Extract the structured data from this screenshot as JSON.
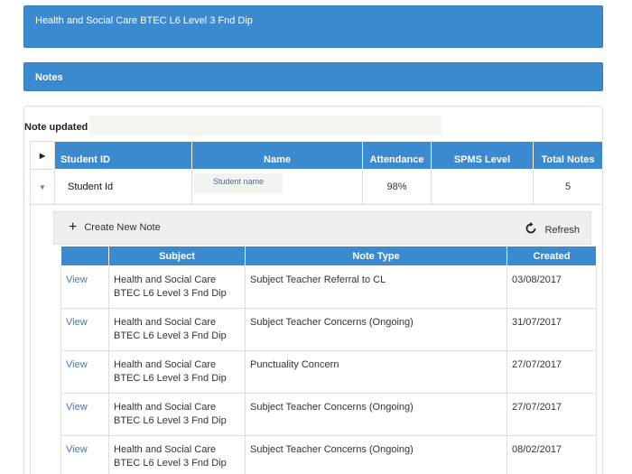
{
  "course_banner": {
    "title": "Health and Social Care BTEC L6 Level 3 Fnd Dip"
  },
  "notes_banner": {
    "title": "Notes"
  },
  "note_updated": {
    "label": "Note updated"
  },
  "student_table": {
    "headers": {
      "student_id": "Student ID",
      "name": "Name",
      "attendance": "Attendance",
      "spms_level": "SPMS Level",
      "total_notes": "Total Notes"
    },
    "row": {
      "student_id": "Student Id",
      "name": "Student name",
      "attendance": "98%",
      "spms_level": "",
      "total_notes": "5"
    }
  },
  "toolbar": {
    "create_label": "Create New Note",
    "refresh_label": "Refresh"
  },
  "notes_table": {
    "headers": {
      "view": "",
      "subject": "Subject",
      "note_type": "Note Type",
      "created": "Created"
    },
    "rows": [
      {
        "view": "View",
        "subject": "Health and Social Care BTEC L6 Level 3 Fnd Dip",
        "note_type": "Subject Teacher Referral to CL",
        "created": "03/08/2017"
      },
      {
        "view": "View",
        "subject": "Health and Social Care BTEC L6 Level 3 Fnd Dip",
        "note_type": "Subject Teacher Concerns (Ongoing)",
        "created": "31/07/2017"
      },
      {
        "view": "View",
        "subject": "Health and Social Care BTEC L6 Level 3 Fnd Dip",
        "note_type": "Punctuality Concern",
        "created": "27/07/2017"
      },
      {
        "view": "View",
        "subject": "Health and Social Care BTEC L6 Level 3 Fnd Dip",
        "note_type": "Subject Teacher Concerns (Ongoing)",
        "created": "27/07/2017"
      },
      {
        "view": "View",
        "subject": "Health and Social Care BTEC L6 Level 3 Fnd Dip",
        "note_type": "Subject Teacher Concerns (Ongoing)",
        "created": "08/02/2017"
      }
    ]
  },
  "icons": {
    "expand": "triangle-right-icon",
    "collapse": "triangle-down-icon",
    "create": "plus-icon",
    "refresh": "refresh-icon"
  },
  "colors": {
    "accent": "#3b8ad0",
    "link": "#3b7bc0"
  }
}
